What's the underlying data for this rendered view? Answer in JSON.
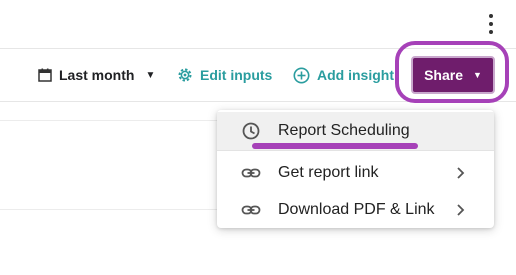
{
  "header": {
    "more_icon": "more-vert-icon"
  },
  "toolbar": {
    "date_range": {
      "label": "Last month",
      "icon": "calendar-icon"
    },
    "edit_inputs": {
      "label": "Edit inputs",
      "icon": "gear-icon"
    },
    "add_insight": {
      "label": "Add insight",
      "icon": "plus-circle-icon"
    },
    "share": {
      "label": "Share"
    }
  },
  "share_menu": {
    "items": [
      {
        "label": "Report Scheduling",
        "icon": "clock-icon",
        "has_submenu": false
      },
      {
        "label": "Get report link",
        "icon": "link-icon",
        "has_submenu": true
      },
      {
        "label": "Download PDF & Link",
        "icon": "link-icon",
        "has_submenu": true
      }
    ]
  },
  "colors": {
    "accent_teal": "#2a9d9f",
    "share_button": "#6f1d6c",
    "highlight_annotation": "#a641b8"
  }
}
